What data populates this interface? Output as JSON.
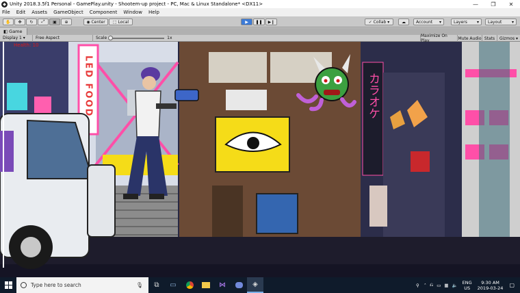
{
  "window": {
    "title": "Unity 2018.3.5f1 Personal - GamePlay.unity - Shootem-up project - PC, Mac & Linux Standalone* <DX11>",
    "minimize": "—",
    "maximize": "❐",
    "close": "✕"
  },
  "menu": [
    "File",
    "Edit",
    "Assets",
    "GameObject",
    "Component",
    "Window",
    "Help"
  ],
  "toolbar": {
    "center": "Center",
    "local": "Local",
    "collab": "Collab ▾",
    "account": "Account",
    "layers": "Layers",
    "layout": "Layout"
  },
  "game": {
    "tab": "Game",
    "display": "Display 1",
    "aspect": "Free Aspect",
    "scale_label": "Scale",
    "scale_value": "1x",
    "maximize_on_play": "Maximize On Play",
    "mute_audio": "Mute Audio",
    "stats": "Stats",
    "gizmos": "Gizmos",
    "health": "Health: 10"
  },
  "scene": {
    "sign_led_food": "LED FOOD",
    "sign_karaoke": "カラオケ"
  },
  "taskbar": {
    "search_placeholder": "Type here to search",
    "lang": "ENG",
    "region": "US",
    "time": "9:30 AM",
    "date": "2019-03-24"
  },
  "colors": {
    "play_blue": "#3d7bd6",
    "health_red": "#e01818",
    "neon_pink": "#ff4fa8",
    "sign_yellow": "#f5dc18",
    "taskbar": "#0f1b2b"
  }
}
